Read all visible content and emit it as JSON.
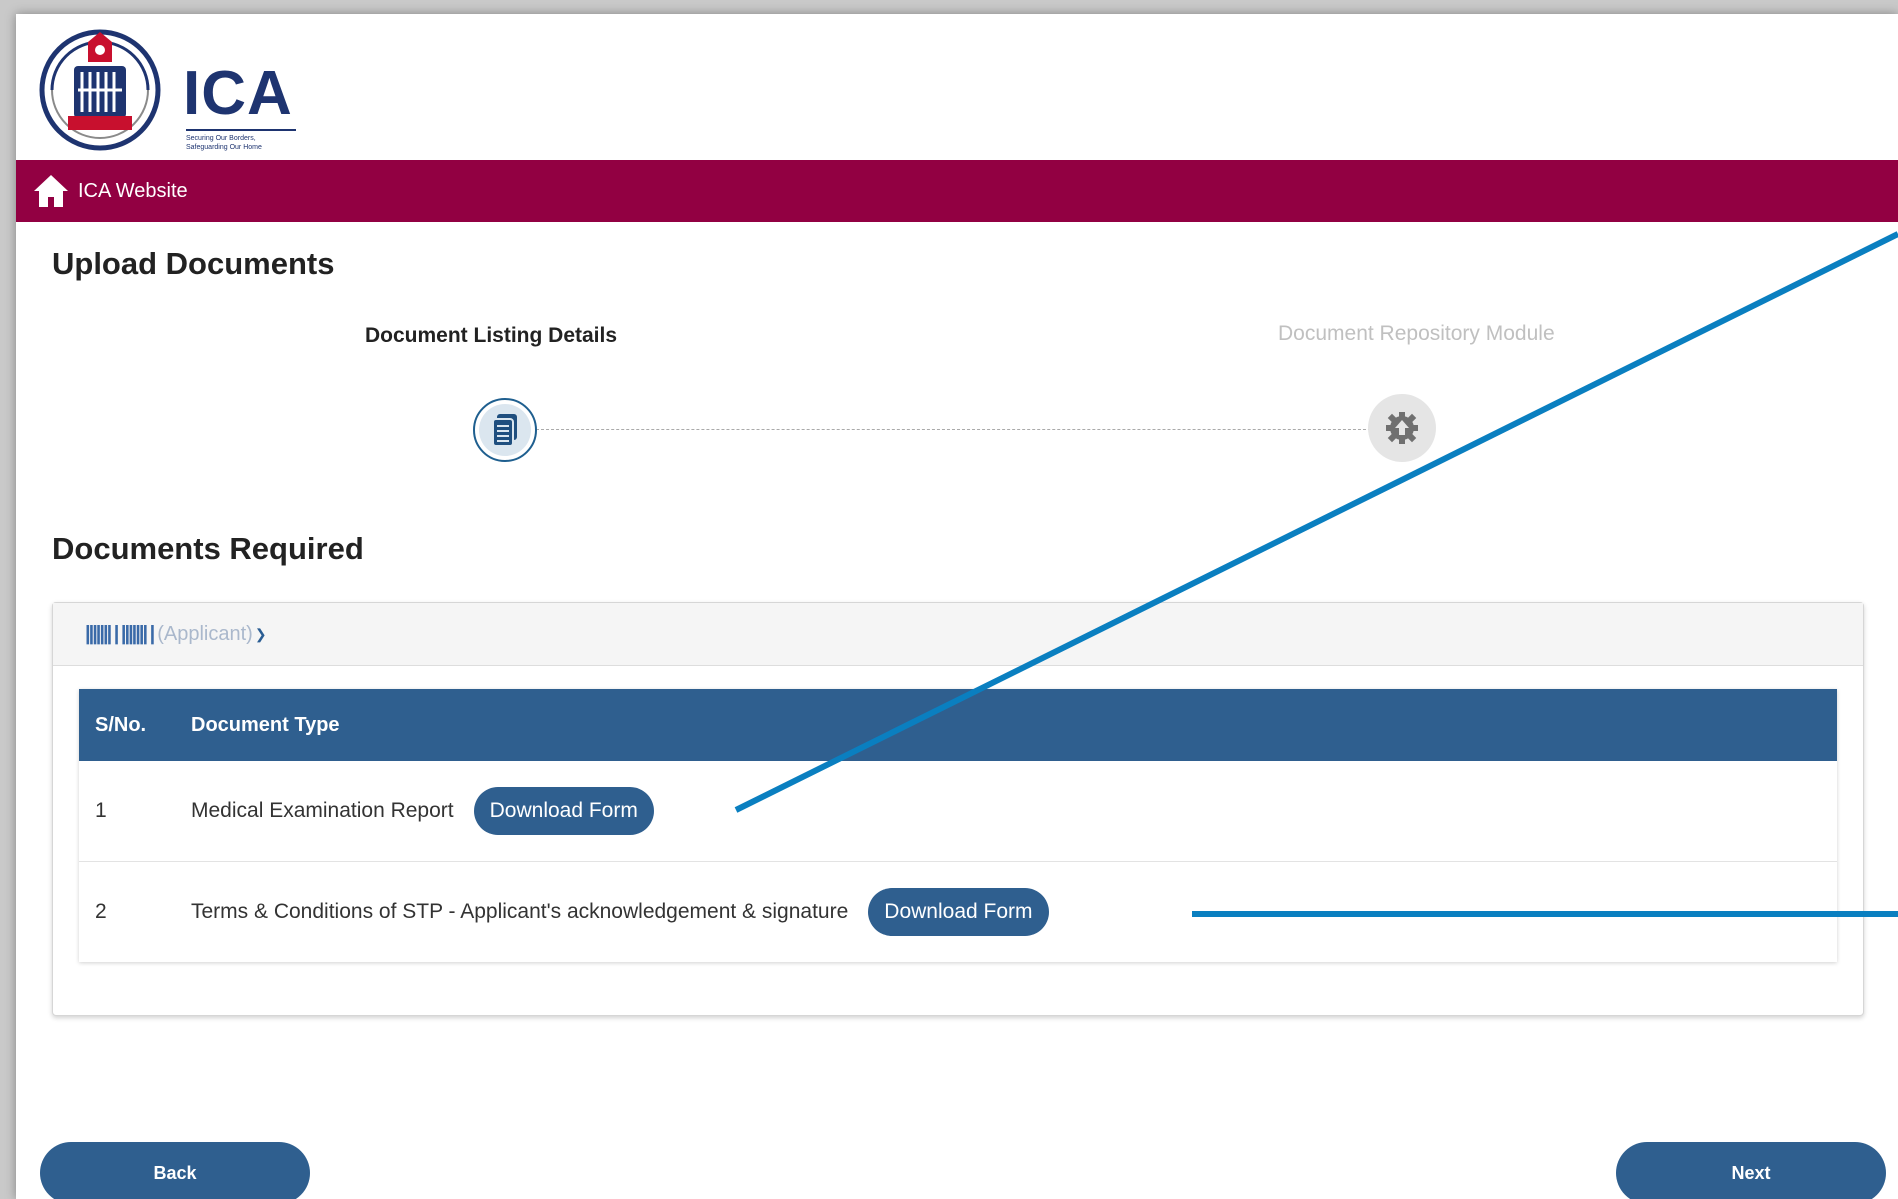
{
  "logo": {
    "text": "ICA",
    "tagline": "Securing Our Borders, Safeguarding Our Home"
  },
  "navbar": {
    "home_label": "ICA Website"
  },
  "page": {
    "title": "Upload Documents"
  },
  "steps": [
    {
      "label": "Document Listing Details",
      "state": "active",
      "icon": "document-icon"
    },
    {
      "label": "Document Repository Module",
      "state": "inactive",
      "icon": "upload-gear-icon"
    }
  ],
  "documents": {
    "section_title": "Documents Required",
    "applicant_name": "||||||| | ||||||| |",
    "applicant_role": "(Applicant)",
    "table_headers": {
      "sn": "S/No.",
      "doc_type": "Document Type"
    },
    "rows": [
      {
        "sn": "1",
        "doc_type": "Medical Examination Report",
        "button": "Download Form"
      },
      {
        "sn": "2",
        "doc_type": "Terms & Conditions of STP - Applicant's acknowledgement & signature",
        "button": "Download Form"
      }
    ]
  },
  "footer": {
    "back_label": "Back",
    "next_label": "Next"
  },
  "colors": {
    "brand_bar": "#920042",
    "primary": "#2f5f8f",
    "annotation": "#0a7fc0"
  }
}
